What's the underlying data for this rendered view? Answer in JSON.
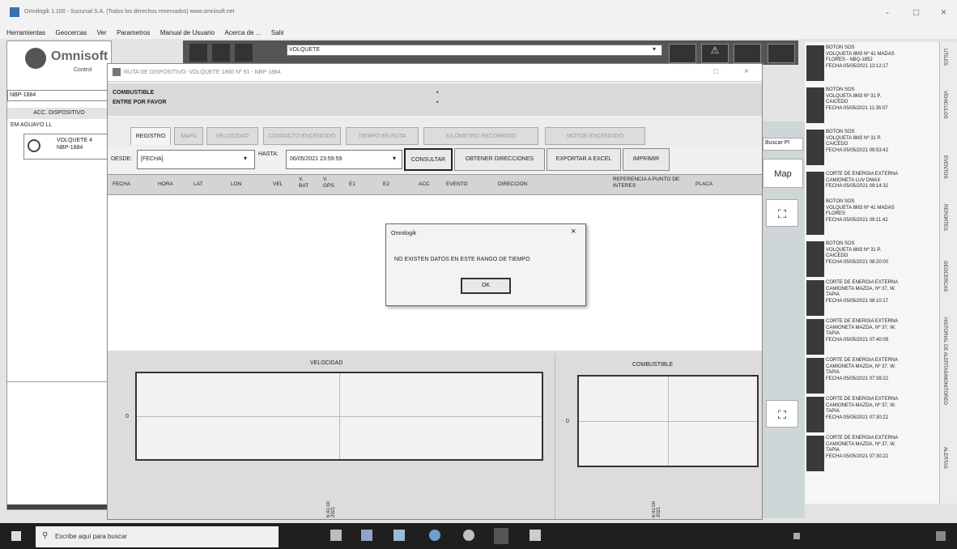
{
  "window": {
    "title": "Omnilogik 1.100 - Sucursal S.A. (Todos los derechos reservados) www.omnisoft.net",
    "controls": [
      "-",
      "□",
      "×"
    ]
  },
  "menu": [
    "Herramientas",
    "Geocercas",
    "Ver",
    "Parametros",
    "Manual de Usuario",
    "Acerca de ...",
    "Salir"
  ],
  "left": {
    "logo": "Omnisoft",
    "logo_sub": "Control",
    "combo": "NBP-1884",
    "header": "ACC. DISPOSITIVO",
    "tree_group": "EM AGUAYO LL",
    "tree_item_line1": "VOLQUETE 4",
    "tree_item_line2": "NBP-1884"
  },
  "toolbar": {
    "search_value": "VOLQUETE"
  },
  "dialog": {
    "title": "RUTA DE DISPOSITIVO: VOLQUETE 1860 Nº 91 - NBP-1884",
    "info_line1": "COMBUSTIBLE",
    "info_line2": "ENTRE POR FAVOR",
    "tabs": [
      "REGISTRO",
      "MAPA",
      "VELOCIDAD",
      "CONTACTO ENCENDIDO",
      "TIEMPO EN RUTA",
      "KILOMETRO RECORRIDO",
      "MOTOR ENCENDIDO"
    ],
    "desde_label": "DESDE:",
    "desde_value": "[FECHA]",
    "hasta_label": "HASTA:",
    "hasta_value": "06/05/2021 23:59:59",
    "buttons": {
      "consultar": "CONSULTAR",
      "obtener": "OBTENER DIRECCIONES",
      "exportar": "EXPORTAR A EXCEL",
      "imprimir": "IMPRIMIR"
    },
    "columns": [
      "FECHA",
      "HORA",
      "LAT",
      "LON",
      "VEL",
      "V. BAT",
      "V. GPS",
      "E1",
      "E2",
      "ACC",
      "EVENTO",
      "DIRECCION",
      "REFERENCIA A PUNTO DE INTERES",
      "PLACA"
    ],
    "chart_left_title": "VELOCIDAD",
    "chart_right_title": "COMBUSTIBLE",
    "chart_zero": "0",
    "chart_left_xtick": "6:41:00 2021",
    "chart_right_xtick": "6:41:00 2021"
  },
  "modal": {
    "title": "Omnilogik",
    "message": "NO EXISTEN DATOS EN ESTE RANGO DE TIEMPO",
    "ok": "OK"
  },
  "alerts": [
    "BOTON SOS\nVOLQUETA 8M3 Nº 41 MADAS\nFLORES - NBQ-1852\nFECHA:05/05/2021 13:12:17",
    "BOTON SOS\nVOLQUETA 8M3 Nº 31 P.\nCAICEDO\nFECHA:05/05/2021 11:35:07",
    "BOTON SOS\nVOLQUETA 8M3 Nº 31 P.\nCAICEDO\nFECHA:05/05/2021 09:53:42",
    "CORTE DE ENERGIA EXTERNA\nCAMIONETA LUV DMAX\nFECHA:05/05/2021 09:14:32",
    "BOTON SOS\nVOLQUETA 8M3 Nº 41 MADAS\nFLORES\nFECHA:05/05/2021 09:11:42",
    "BOTON SOS\nVOLQUETA 8M3 Nº 31 P.\nCAICEDO\nFECHA:05/05/2021 08:20:00",
    "CORTE DE ENERGIA EXTERNA\nCAMIONETA MAZDA, Nº 37, W.\nTAPIA\nFECHA:05/05/2021 08:10:17",
    "CORTE DE ENERGIA EXTERNA\nCAMIONETA MAZDA, Nº 37, W.\nTAPIA\nFECHA:05/05/2021 07:40:09",
    "CORTE DE ENERGIA EXTERNA\nCAMIONETA MAZDA, Nº 37, W.\nTAPIA\nFECHA:05/05/2021 07:39:22",
    "CORTE DE ENERGIA EXTERNA\nCAMIONETA MAZDA, Nº 37, W.\nTAPIA\nFECHA:05/05/2021 07:30:22",
    "CORTE DE ENERGIA EXTERNA\nCAMIONETA MAZDA, Nº 37, W.\nTAPIA\nFECHA:05/05/2021 07:30:22"
  ],
  "right_tabs": [
    "UTILES",
    "VEHICULOS",
    "EVENTOS",
    "REPORTES",
    "GEOCERCAS",
    "HISTORIAL DE ALERTAS/MONITOREO",
    "ALERTAS"
  ],
  "map": {
    "tab": "Buscar Pl",
    "map_btn": "Map",
    "fullscreen_glyph": "⛶"
  },
  "taskbar": {
    "search_placeholder": "Escribe aquí para buscar"
  }
}
